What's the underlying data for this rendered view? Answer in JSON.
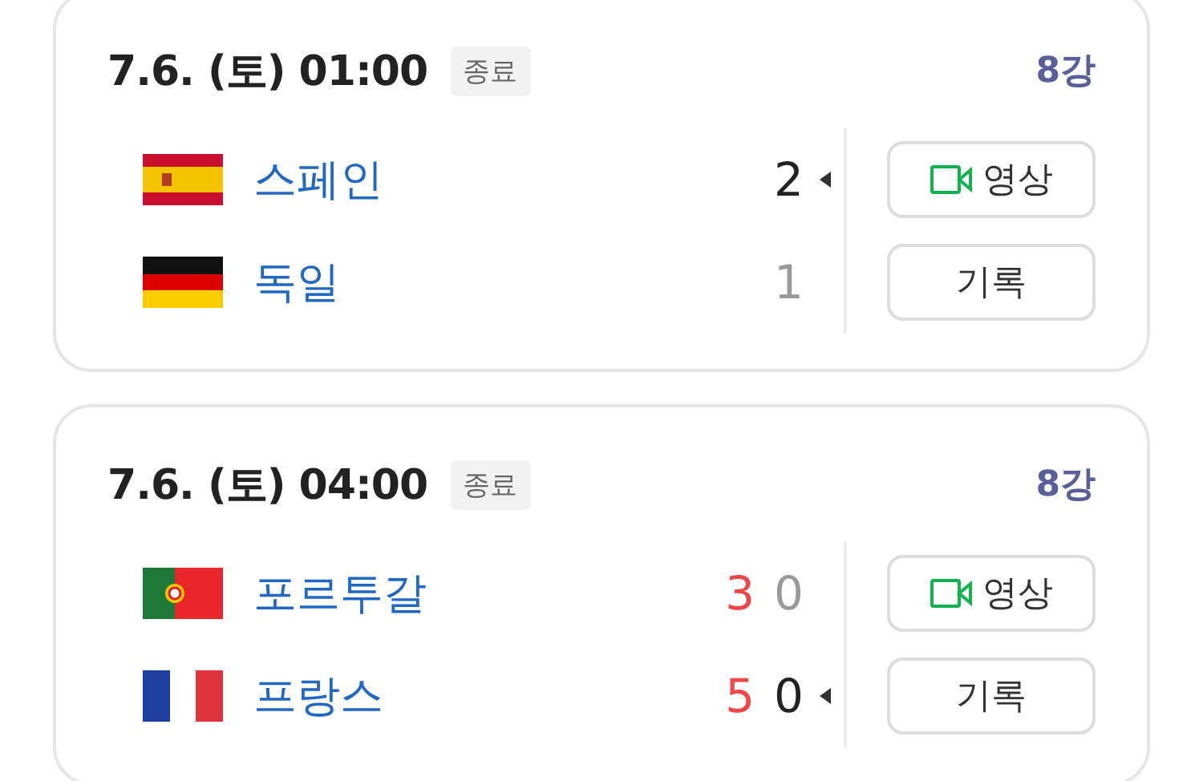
{
  "matches": [
    {
      "time": "7.6. (토) 01:00",
      "status": "종료",
      "round": "8강",
      "teams": [
        {
          "kind": "spain",
          "name": "스페인",
          "score": "2",
          "winner": true
        },
        {
          "kind": "germany",
          "name": "독일",
          "score": "1",
          "winner": false
        }
      ],
      "buttons": [
        {
          "kind": "video",
          "label": "영상"
        },
        {
          "kind": "record",
          "label": "기록"
        }
      ]
    },
    {
      "time": "7.6. (토) 04:00",
      "status": "종료",
      "round": "8강",
      "teams": [
        {
          "kind": "portugal",
          "name": "포르투갈",
          "penalty": "3",
          "score": "0",
          "winner": false
        },
        {
          "kind": "france",
          "name": "프랑스",
          "penalty": "5",
          "score": "0",
          "winner": true
        }
      ],
      "buttons": [
        {
          "kind": "video",
          "label": "영상"
        },
        {
          "kind": "record",
          "label": "기록"
        }
      ]
    }
  ]
}
